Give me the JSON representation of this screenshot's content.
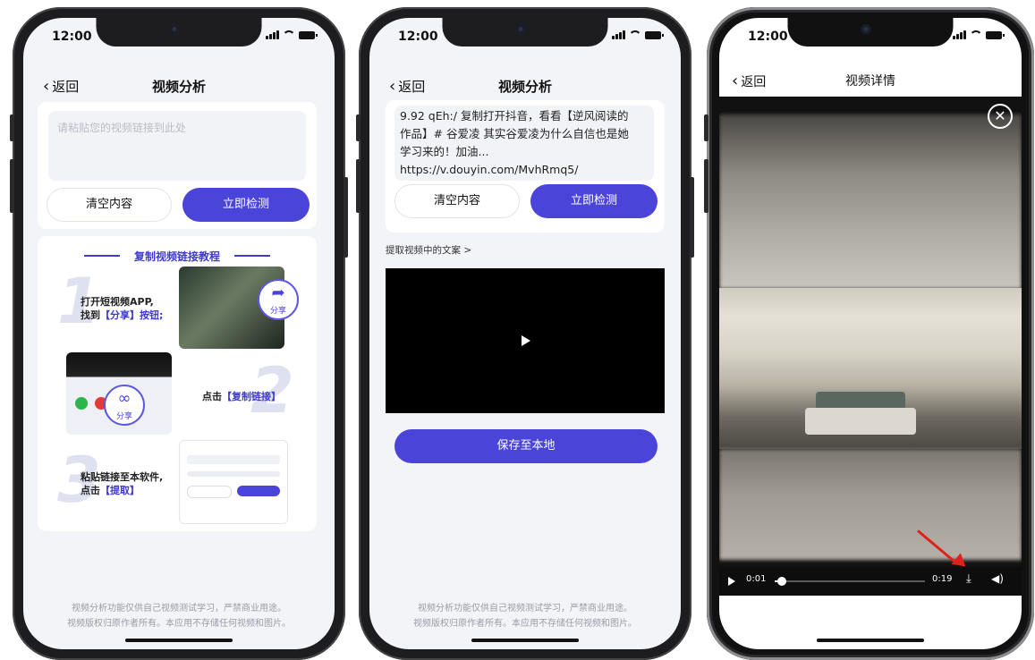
{
  "status": {
    "time": "12:00"
  },
  "phone1": {
    "back_label": "返回",
    "title": "视频分析",
    "input_placeholder": "请粘贴您的视频链接到此处",
    "clear_button": "清空内容",
    "detect_button": "立即检测",
    "tutorial": {
      "title": "复制视频链接教程",
      "step1_line1": "打开短视频APP,",
      "step1_line2_prefix": "找到",
      "step1_line2_highlight": "【分享】按钮;",
      "step2_prefix": "点击",
      "step2_highlight": "【复制链接】",
      "step3_line1": "粘贴链接至本软件,",
      "step3_line2_prefix": "点击",
      "step3_line2_highlight": "【提取】",
      "share_badge": "分享",
      "numbers": [
        "1",
        "2",
        "3"
      ]
    },
    "footer_line1": "视频分析功能仅供自己视频测试学习，严禁商业用途。",
    "footer_line2": "视频版权归原作者所有。本应用不存储任何视频和图片。"
  },
  "phone2": {
    "back_label": "返回",
    "title": "视频分析",
    "input_value_line1": "9.92 qEh:/ 复制打开抖音，看看【逆风阅读的",
    "input_value_line2": "作品】# 谷爱凌 其实谷爱凌为什么自信也是她",
    "input_value_line3": "学习来的！加油...",
    "input_value_line4": "https://v.douyin.com/MvhRmq5/",
    "clear_button": "清空内容",
    "detect_button": "立即检测",
    "extract_link": "提取视频中的文案 >",
    "save_button": "保存至本地",
    "footer_line1": "视频分析功能仅供自己视频测试学习，严禁商业用途。",
    "footer_line2": "视频版权归原作者所有。本应用不存储任何视频和图片。"
  },
  "phone3": {
    "back_label": "返回",
    "title": "视频详情",
    "current_time": "0:01",
    "duration": "0:19",
    "progress": 0.05
  },
  "colors": {
    "accent": "#4a44d8",
    "arrow": "#e0201a"
  }
}
